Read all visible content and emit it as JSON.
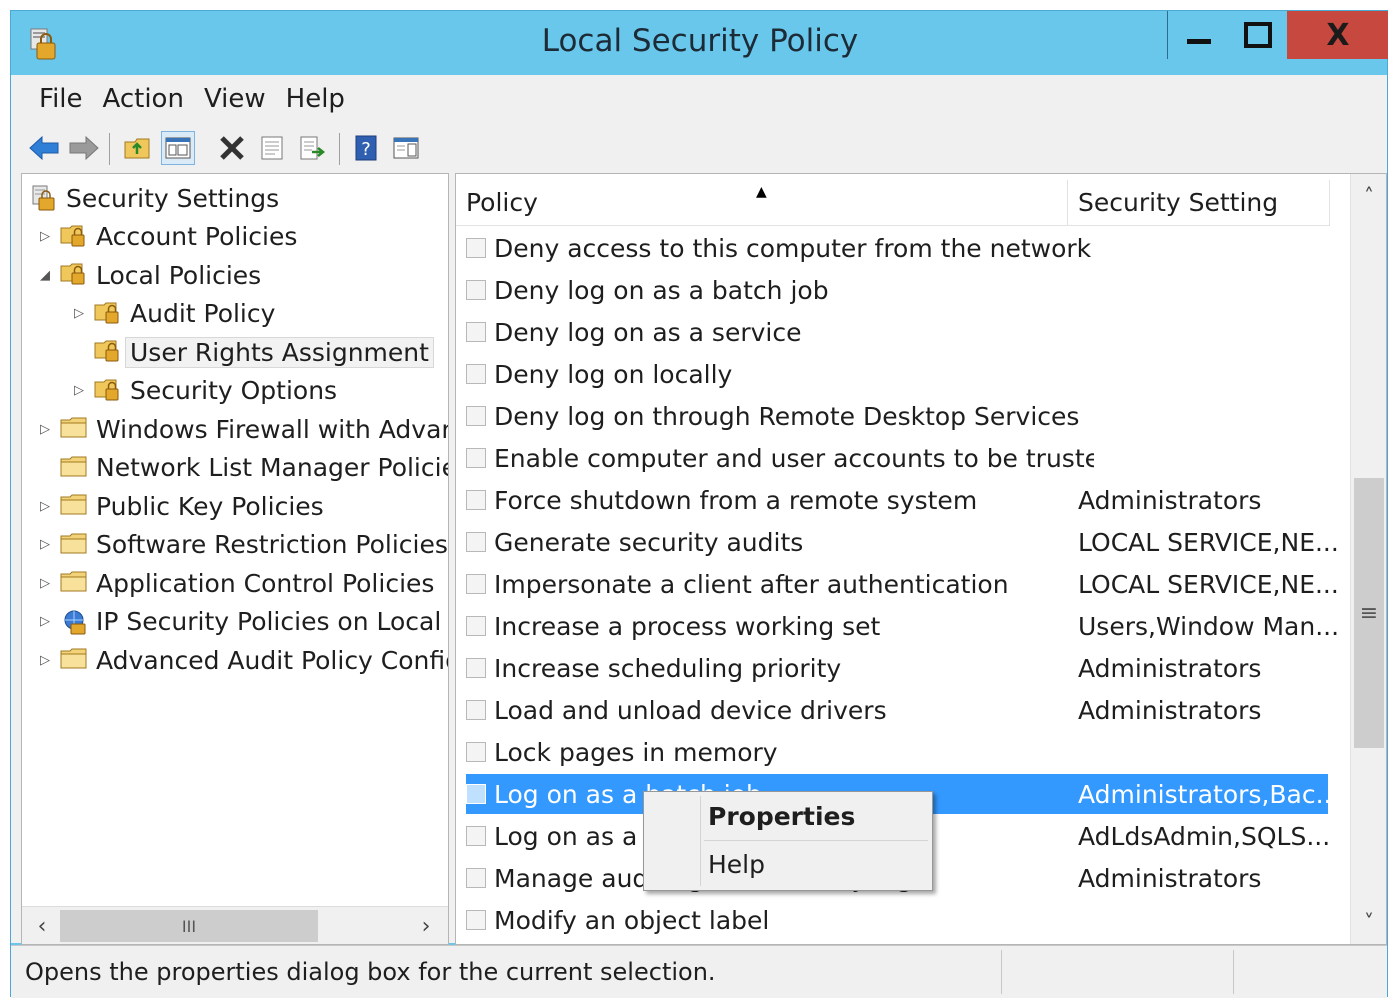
{
  "window": {
    "title": "Local Security Policy",
    "minimize_glyph": "",
    "maximize_glyph": "",
    "close_glyph": "X"
  },
  "menu": [
    "File",
    "Action",
    "View",
    "Help"
  ],
  "toolbar": {
    "icons": [
      "back-arrow-icon",
      "forward-arrow-icon",
      "up-folder-icon",
      "show-hide-tree-icon",
      "delete-icon",
      "properties-icon",
      "export-list-icon",
      "help-icon",
      "action-pane-icon"
    ]
  },
  "tree": {
    "items": [
      {
        "label": "Security Settings",
        "icon": "security-settings-icon",
        "arrow": ""
      },
      {
        "label": "Account Policies",
        "icon": "folder-lock-icon",
        "arrow": "▷"
      },
      {
        "label": "Local Policies",
        "icon": "folder-lock-icon",
        "arrow": "◢"
      },
      {
        "label": "Audit Policy",
        "icon": "folder-lock-icon",
        "arrow": "▷"
      },
      {
        "label": "User Rights Assignment",
        "icon": "folder-lock-icon",
        "arrow": ""
      },
      {
        "label": "Security Options",
        "icon": "folder-lock-icon",
        "arrow": "▷"
      },
      {
        "label": "Windows Firewall with Advanc",
        "icon": "folder-icon",
        "arrow": "▷"
      },
      {
        "label": "Network List Manager Policies",
        "icon": "folder-icon",
        "arrow": ""
      },
      {
        "label": "Public Key Policies",
        "icon": "folder-icon",
        "arrow": "▷"
      },
      {
        "label": "Software Restriction Policies",
        "icon": "folder-icon",
        "arrow": "▷"
      },
      {
        "label": "Application Control Policies",
        "icon": "folder-icon",
        "arrow": "▷"
      },
      {
        "label": "IP Security Policies on Local C",
        "icon": "ip-security-icon",
        "arrow": "▷"
      },
      {
        "label": "Advanced Audit Policy Config",
        "icon": "folder-icon",
        "arrow": "▷"
      }
    ],
    "hscroll_thumb": "III"
  },
  "list": {
    "columns": [
      "Policy",
      "Security Setting"
    ],
    "rows": [
      {
        "policy": "Deny access to this computer from the network",
        "setting": ""
      },
      {
        "policy": "Deny log on as a batch job",
        "setting": ""
      },
      {
        "policy": "Deny log on as a service",
        "setting": ""
      },
      {
        "policy": "Deny log on locally",
        "setting": ""
      },
      {
        "policy": "Deny log on through Remote Desktop Services",
        "setting": ""
      },
      {
        "policy": "Enable computer and user accounts to be truste...",
        "setting": ""
      },
      {
        "policy": "Force shutdown from a remote system",
        "setting": "Administrators"
      },
      {
        "policy": "Generate security audits",
        "setting": "LOCAL SERVICE,NE..."
      },
      {
        "policy": "Impersonate a client after authentication",
        "setting": "LOCAL SERVICE,NE..."
      },
      {
        "policy": "Increase a process working set",
        "setting": "Users,Window Man..."
      },
      {
        "policy": "Increase scheduling priority",
        "setting": "Administrators"
      },
      {
        "policy": "Load and unload device drivers",
        "setting": "Administrators"
      },
      {
        "policy": "Lock pages in memory",
        "setting": ""
      },
      {
        "policy": "Log on as a batch job",
        "setting": "Administrators,Bac..."
      },
      {
        "policy": "Log on as a service",
        "setting": "AdLdsAdmin,SQLS..."
      },
      {
        "policy": "Manage auditing and security log",
        "setting": "Administrators"
      },
      {
        "policy": "Modify an object label",
        "setting": ""
      }
    ],
    "vscroll_thumb": "≡"
  },
  "context_menu": {
    "items": [
      "Properties",
      "Help"
    ]
  },
  "status": {
    "text": "Opens the properties dialog box for the current selection."
  },
  "colors": {
    "titlebar": "#69c7ec",
    "selection": "#3399ff",
    "close_button": "#c7483e"
  }
}
